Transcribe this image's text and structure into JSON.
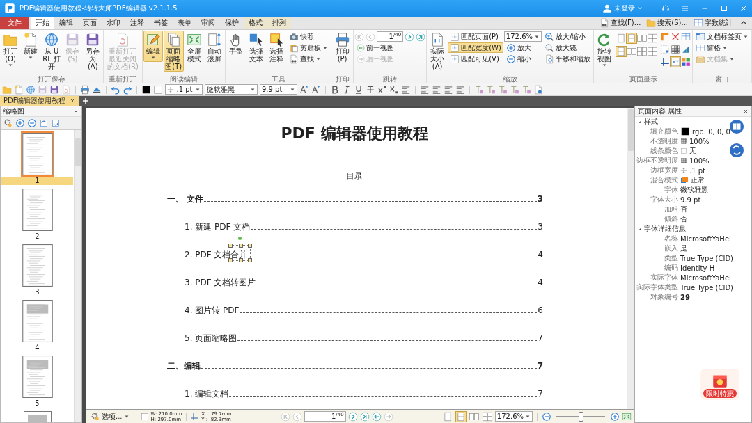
{
  "title_bar": {
    "title": "PDF编辑器使用教程-转转大师PDF编辑器 v2.1.1.5",
    "user": "未登录"
  },
  "menu_tabs": [
    {
      "label": "文件",
      "kind": "file",
      "selected": false
    },
    {
      "label": "开始",
      "kind": "tab",
      "selected": true
    },
    {
      "label": "编辑",
      "kind": "tab",
      "selected": false
    },
    {
      "label": "页面",
      "kind": "tab",
      "selected": false
    },
    {
      "label": "水印",
      "kind": "tab",
      "selected": false
    },
    {
      "label": "注释",
      "kind": "tab",
      "selected": false
    },
    {
      "label": "书签",
      "kind": "tab",
      "selected": false
    },
    {
      "label": "表单",
      "kind": "tab",
      "selected": false
    },
    {
      "label": "审阅",
      "kind": "tab",
      "selected": false
    },
    {
      "label": "保护",
      "kind": "tab",
      "selected": false
    },
    {
      "label": "格式",
      "kind": "context",
      "selected": false
    },
    {
      "label": "排列",
      "kind": "context",
      "selected": false
    }
  ],
  "quick_actions": [
    {
      "label": "查找(F)..."
    },
    {
      "label": "搜索(S)..."
    },
    {
      "label": "字数统计"
    }
  ],
  "ribbon": [
    {
      "kind": "buttons",
      "label": "打开保存",
      "items": [
        {
          "label": "打开(O)",
          "dropdown": true,
          "disabled": false,
          "selected": false
        },
        {
          "label": "新建",
          "dropdown": true,
          "disabled": false,
          "selected": false
        },
        {
          "label": "从 URL 打开",
          "dropdown": false,
          "disabled": false,
          "selected": false
        },
        {
          "label": "保存(S)",
          "dropdown": false,
          "disabled": true,
          "selected": false
        },
        {
          "label": "另存为(A)",
          "dropdown": false,
          "disabled": false,
          "selected": false
        }
      ]
    },
    {
      "kind": "buttons",
      "label": "重新打开",
      "items": [
        {
          "label": "重新打开最近关闭的文档(R)",
          "dropdown": false,
          "disabled": true,
          "selected": false
        }
      ]
    },
    {
      "kind": "buttons",
      "label": "阅读编辑",
      "items": [
        {
          "label": "编辑",
          "dropdown": true,
          "disabled": false,
          "selected": true
        },
        {
          "label": "页面缩略图(T)",
          "dropdown": false,
          "disabled": false,
          "selected": true
        },
        {
          "label": "全屏模式",
          "dropdown": false,
          "disabled": false,
          "selected": false
        },
        {
          "label": "自动滚屏",
          "dropdown": false,
          "disabled": false,
          "selected": false
        }
      ]
    },
    {
      "kind": "buttons",
      "label": "工具",
      "items": [
        {
          "label": "手型",
          "dropdown": false,
          "disabled": false,
          "selected": false
        },
        {
          "label": "选择文本",
          "dropdown": false,
          "disabled": false,
          "selected": false
        },
        {
          "label": "选择注释",
          "dropdown": false,
          "disabled": false,
          "selected": false
        }
      ],
      "small": [
        {
          "label": "快照",
          "dropdown": false
        },
        {
          "label": "剪贴板",
          "dropdown": true
        },
        {
          "label": "查找",
          "dropdown": true
        }
      ]
    },
    {
      "kind": "buttons",
      "label": "打印",
      "items": [
        {
          "label": "打印(P)",
          "dropdown": false,
          "disabled": false,
          "selected": false
        }
      ]
    },
    {
      "kind": "nav",
      "label": "跳转",
      "page": "1",
      "total": "/40",
      "buttons": [
        {
          "disabled": true
        },
        {
          "disabled": true
        },
        {
          "disabled": false
        },
        {
          "disabled": false
        }
      ],
      "links": [
        {
          "label": "前一视图",
          "disabled": false
        },
        {
          "label": "后一视图",
          "disabled": true
        }
      ]
    },
    {
      "kind": "zoom",
      "label": "缩放",
      "actual": "实际大小(A)",
      "fit": [
        {
          "label": "匹配页面(P)",
          "selected": false
        },
        {
          "label": "匹配宽度(W)",
          "selected": true
        },
        {
          "label": "匹配可见(V)",
          "selected": false
        }
      ],
      "zoom_value": "172.6%",
      "zoom_buttons": [
        {
          "label": "放大"
        },
        {
          "label": "缩小"
        }
      ],
      "tools": [
        {
          "label": "放大/缩小"
        },
        {
          "label": "放大镜"
        },
        {
          "label": "平移和缩放"
        }
      ]
    },
    {
      "kind": "page_display",
      "label": "页面显示",
      "rotate": "旋转视图",
      "layouts": [
        {
          "selected": false
        },
        {
          "selected": true
        },
        {
          "selected": false
        },
        {
          "selected": false
        },
        {
          "selected": true
        },
        {
          "selected": false
        },
        {
          "selected": false
        },
        {
          "selected": false
        }
      ],
      "tools": [
        {
          "selected": false
        },
        {
          "selected": false
        },
        {
          "selected": false
        },
        {
          "selected": false
        },
        {
          "selected": false
        },
        {
          "selected": false
        },
        {
          "selected": false
        },
        {
          "selected": true
        },
        {
          "selected": false
        }
      ]
    },
    {
      "kind": "window",
      "label": "窗口",
      "items": [
        {
          "label": "文档标签页",
          "disabled": false
        },
        {
          "label": "窗格",
          "disabled": false
        },
        {
          "label": "文档集",
          "disabled": true
        }
      ]
    }
  ],
  "format_toolbar": {
    "line_width": ".1 pt",
    "font": "微软雅黑",
    "font_size": "9.9 pt"
  },
  "doc_tabs": [
    {
      "label": "PDF编辑器使用教程",
      "selected": true
    }
  ],
  "thumbnails": {
    "title": "缩略图",
    "pages": [
      {
        "label": "1",
        "selected": true
      },
      {
        "label": "2",
        "selected": false
      },
      {
        "label": "3",
        "selected": false
      },
      {
        "label": "4",
        "selected": false
      },
      {
        "label": "5",
        "selected": false
      }
    ]
  },
  "document": {
    "title": "PDF 编辑器使用教程",
    "toc_heading": "目录",
    "toc": [
      {
        "label": "一、 文件",
        "page": "3",
        "selected": false,
        "children": [
          {
            "label": "1. 新建 PDF 文档",
            "page": "3",
            "selected": false
          },
          {
            "label": "2. PDF 文档合并",
            "page": "4",
            "selected": true
          },
          {
            "label": "3. PDF 文档转图片",
            "page": "4",
            "selected": false
          },
          {
            "label": "4. 图片转 PDF",
            "page": "6",
            "selected": false
          },
          {
            "label": "5. 页面缩略图",
            "page": "7",
            "selected": false
          }
        ]
      },
      {
        "label": "二、编辑",
        "page": "7",
        "selected": false,
        "children": [
          {
            "label": "1. 编辑文档",
            "page": "7",
            "selected": false
          }
        ]
      }
    ]
  },
  "properties": {
    "title": "页面内容 属性",
    "sections": [
      {
        "label": "样式",
        "expanded": true,
        "rows": [
          {
            "label": "填充颜色",
            "value": "rgb: 0, 0, 0",
            "kind": "fill"
          },
          {
            "label": "不透明度",
            "value": "100%",
            "kind": "opacity"
          },
          {
            "label": "线条颜色",
            "value": "无",
            "kind": "empty"
          },
          {
            "label": "边框不透明度",
            "value": "100%",
            "kind": "opacity"
          },
          {
            "label": "边框宽度",
            "value": ".1 pt",
            "kind": "width"
          },
          {
            "label": "混合模式",
            "value": "正常",
            "kind": "blend"
          },
          {
            "label": "字体",
            "value": "微软雅黑",
            "kind": "text"
          },
          {
            "label": "字体大小",
            "value": "9.9 pt",
            "kind": "text"
          },
          {
            "label": "加粗",
            "value": "否",
            "kind": "text"
          },
          {
            "label": "倾斜",
            "value": "否",
            "kind": "text"
          }
        ]
      },
      {
        "label": "字体详细信息",
        "expanded": true,
        "rows": [
          {
            "label": "名称",
            "value": "MicrosoftYaHei",
            "kind": "text"
          },
          {
            "label": "嵌入",
            "value": "是",
            "kind": "text"
          },
          {
            "label": "类型",
            "value": "True Type (CID)",
            "kind": "text"
          },
          {
            "label": "编码",
            "value": "Identity-H",
            "kind": "text"
          },
          {
            "label": "实际字体",
            "value": "MicrosoftYaHei",
            "kind": "text"
          },
          {
            "label": "实际字体类型",
            "value": "True Type (CID)",
            "kind": "text"
          },
          {
            "label": "对象编号",
            "value": "29",
            "kind": "strong"
          }
        ]
      }
    ]
  },
  "status_bar": {
    "options": "选项...",
    "width": "W: 210.0mm",
    "height": "H: 297.0mm",
    "x": "X :  79.7mm",
    "y": "Y :  82.3mm",
    "page": "1",
    "total": "/40",
    "nav": [
      {
        "disabled": true
      },
      {
        "disabled": true
      },
      {
        "disabled": false
      },
      {
        "disabled": false
      },
      {
        "disabled": false
      },
      {
        "disabled": true
      }
    ],
    "layouts": [
      {
        "selected": false
      },
      {
        "selected": true
      },
      {
        "selected": false
      },
      {
        "selected": false
      }
    ],
    "zoom": "172.6%",
    "zoom_slider": {
      "level": 0.5
    }
  },
  "promo": {
    "label": "限时特惠"
  }
}
